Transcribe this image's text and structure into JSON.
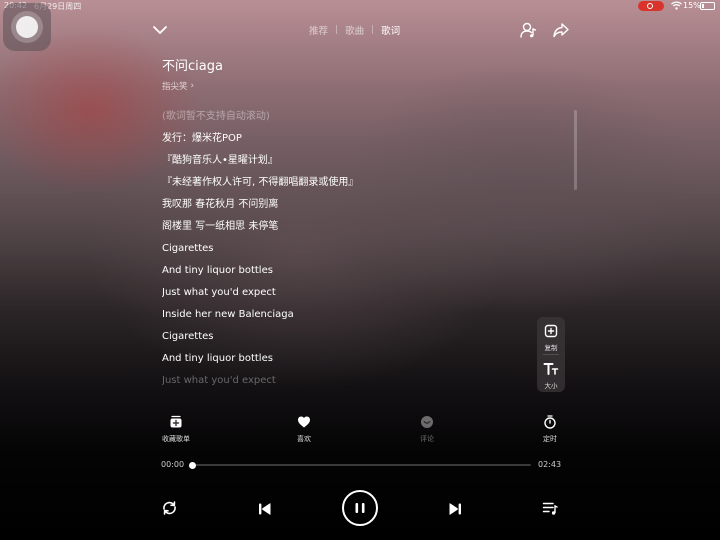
{
  "status_bar": {
    "time": "20:42",
    "date": "6月29日周四",
    "battery": "15%",
    "battery_level": 0.15,
    "record_color": "#d9342b"
  },
  "nav": {
    "tabs": [
      {
        "label": "推荐",
        "active": false
      },
      {
        "label": "歌曲",
        "active": false
      },
      {
        "label": "歌词",
        "active": true
      }
    ],
    "icons": [
      "chevron-down-icon",
      "music-assistant-icon",
      "share-icon"
    ]
  },
  "song": {
    "title": "不问ciaga",
    "artist": "指尖笑",
    "artist_chevron": "›"
  },
  "lyrics": {
    "notice": "(歌词暂不支持自动滚动)",
    "lines": [
      "发行：爆米花POP",
      "『酷狗音乐人•星曜计划』",
      "『未经著作权人许可, 不得翻唱翻录或使用』",
      "我叹那 春花秋月 不问别离",
      "阁楼里 写一纸相思 未停笔",
      "Cigarettes",
      "And tiny liquor bottles",
      "Just what you'd expect",
      "Inside her new Balenciaga",
      "Cigarettes",
      "And tiny liquor bottles",
      "Just what you'd expect"
    ]
  },
  "side_tools": [
    {
      "label": "复制",
      "icon": "copy-plus-icon"
    },
    {
      "label": "大小",
      "icon": "font-size-icon"
    }
  ],
  "actions": [
    {
      "label": "收藏歌单",
      "icon": "add-to-playlist-icon"
    },
    {
      "label": "喜欢",
      "icon": "heart-icon"
    },
    {
      "label": "评论",
      "icon": "comment-icon"
    },
    {
      "label": "定时",
      "icon": "timer-icon"
    }
  ],
  "playback": {
    "current": "00:00",
    "total": "02:43",
    "progress": 0.0,
    "state": "playing",
    "controls": [
      "repeat-icon",
      "previous-icon",
      "pause-icon",
      "next-icon",
      "playlist-icon"
    ]
  },
  "colors": {
    "accent": "#ffffff",
    "text_dim": "rgba(255,255,255,0.42)"
  }
}
